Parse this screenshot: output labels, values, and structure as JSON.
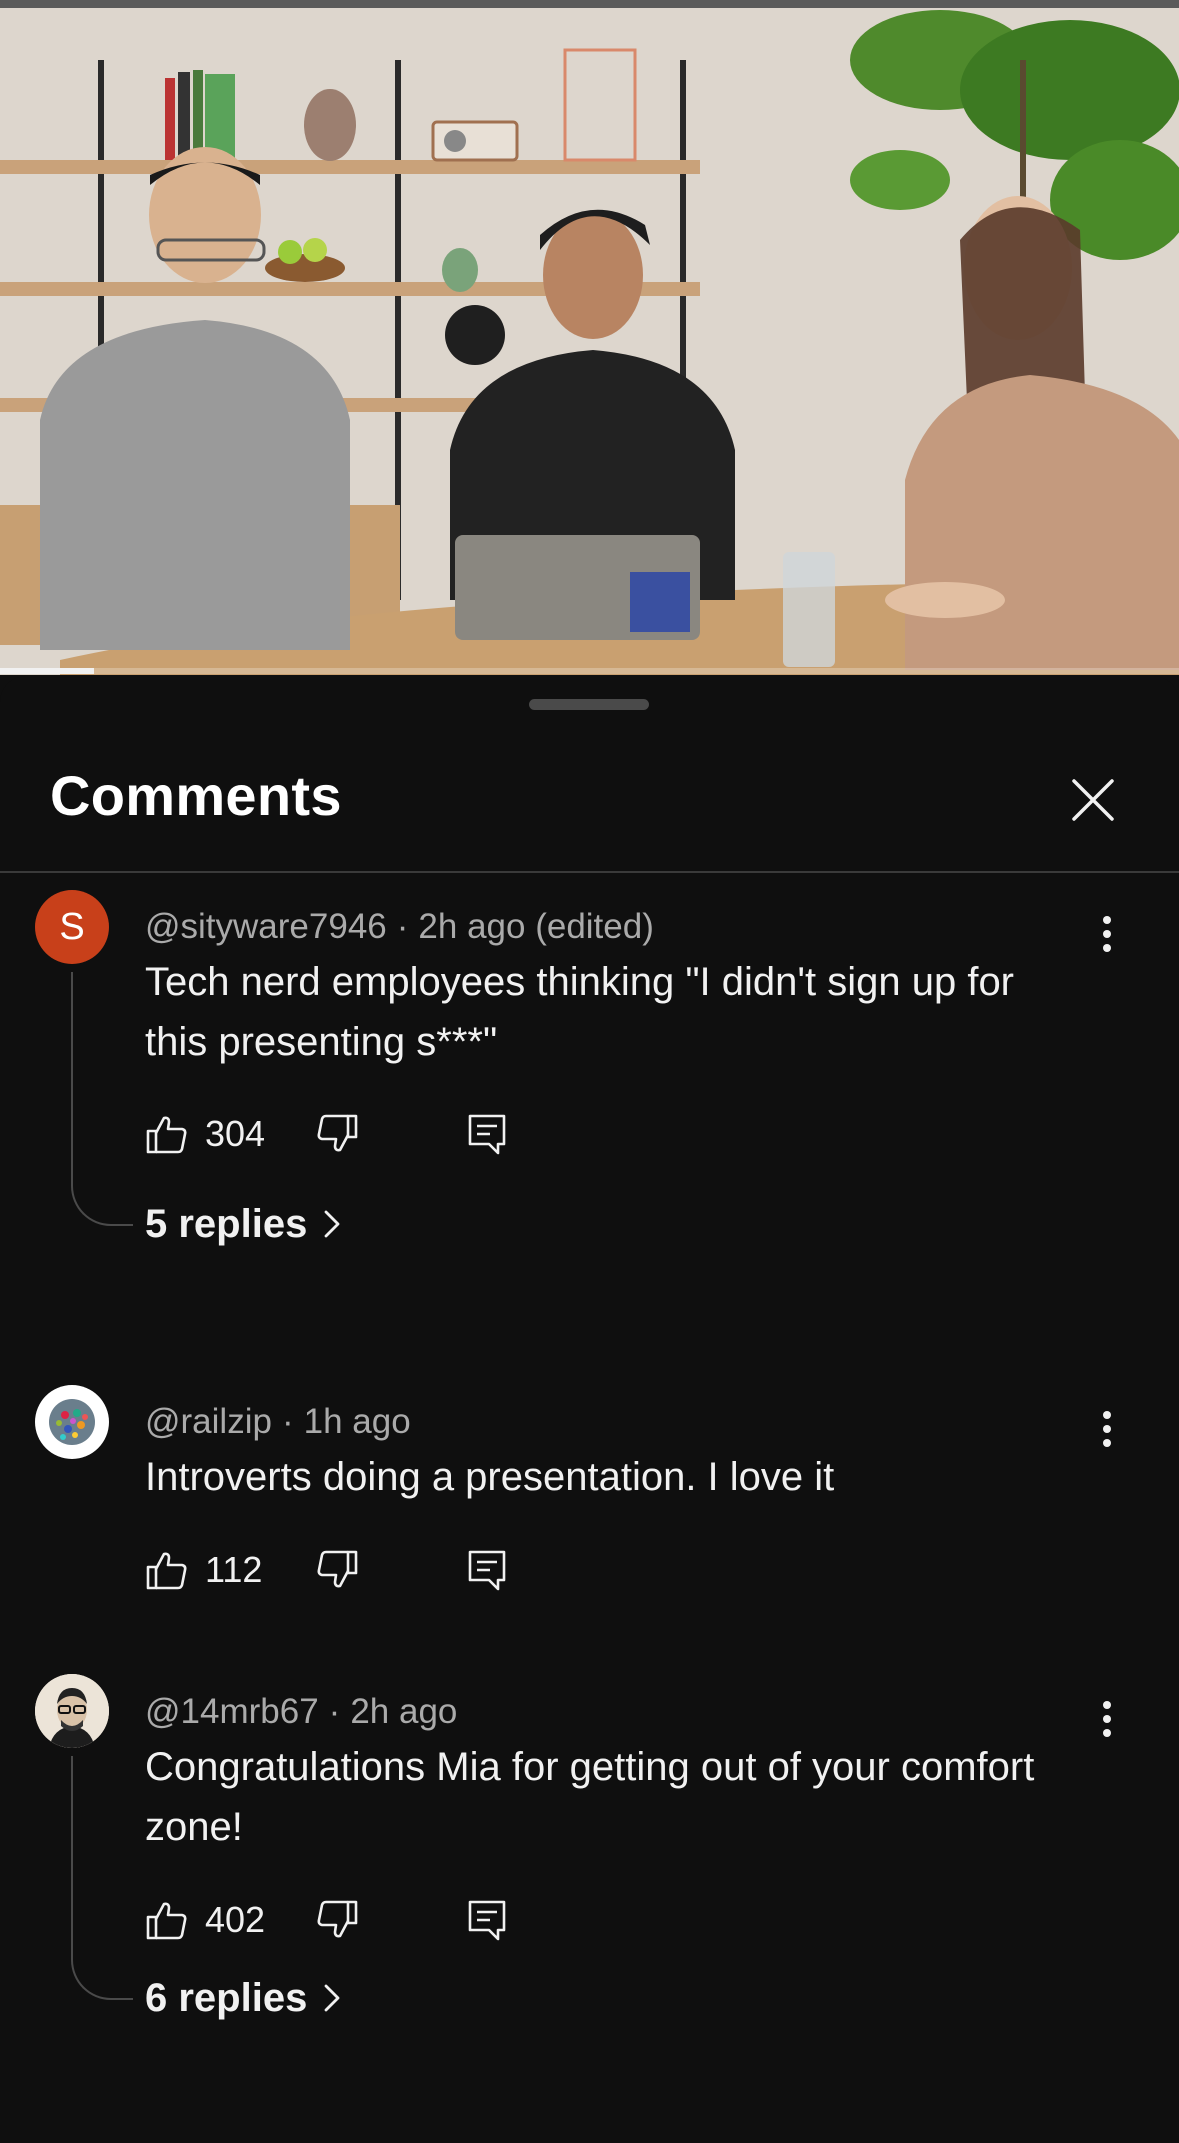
{
  "video": {
    "progress_fraction": 0.08
  },
  "comments_sheet": {
    "title": "Comments"
  },
  "comments": [
    {
      "avatar_letter": "S",
      "avatar_color": "#c8401a",
      "author": "@sityware7946",
      "time": "2h ago (edited)",
      "text": "Tech nerd employees thinking \"I didn't sign up for this presenting s***\"",
      "likes": "304",
      "replies_label": "5 replies"
    },
    {
      "author": "@railzip",
      "time": "1h ago",
      "text": "Introverts doing a presentation. I love it",
      "likes": "112"
    },
    {
      "author": "@14mrb67",
      "time": "2h ago",
      "text": "Congratulations Mia for getting out of your comfort zone!",
      "likes": "402",
      "replies_label": "6 replies"
    }
  ],
  "icons": {
    "like": "thumbs-up-icon",
    "dislike": "thumbs-down-icon",
    "reply": "reply-comment-icon",
    "more": "more-vertical-icon",
    "close": "close-icon",
    "chevron": "chevron-right-icon"
  },
  "colors": {
    "background": "#0f0f0f",
    "text_primary": "#f1f1f1",
    "text_secondary": "#aaaaaa",
    "avatar_s": "#c8401a"
  }
}
